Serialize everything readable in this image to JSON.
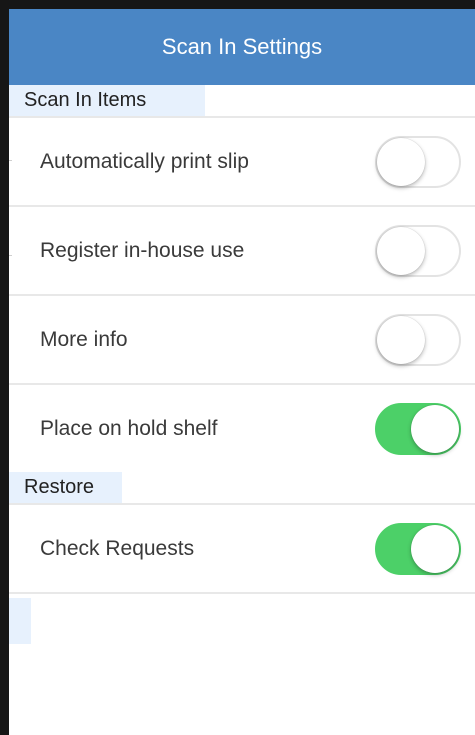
{
  "header": {
    "title": "Scan In Settings",
    "background": "#4a86c5"
  },
  "sections": [
    {
      "label": "Scan In Items",
      "rows": [
        {
          "label": "Automatically print slip",
          "state": "off"
        },
        {
          "label": "Register in-house use",
          "state": "off"
        },
        {
          "label": "More info",
          "state": "off"
        },
        {
          "label": "Place on hold shelf",
          "state": "on"
        }
      ]
    },
    {
      "label": "Restore",
      "rows": [
        {
          "label": "Check Requests",
          "state": "on"
        }
      ]
    }
  ],
  "colors": {
    "toggle_on": "#4cd068",
    "section_tint": "#e7f1fd"
  }
}
